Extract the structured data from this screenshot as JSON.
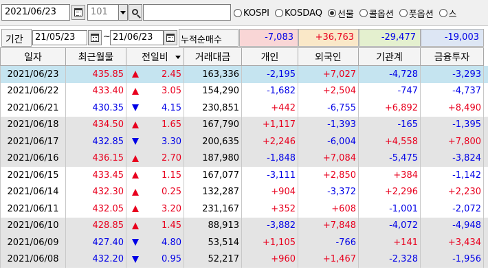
{
  "toolbar": {
    "date": "2021/06/23",
    "code": "101",
    "name": "",
    "radios": [
      {
        "label": "KOSPI",
        "selected": false
      },
      {
        "label": "KOSDAQ",
        "selected": false
      },
      {
        "label": "선물",
        "selected": true
      },
      {
        "label": "콜옵션",
        "selected": false
      },
      {
        "label": "풋옵션",
        "selected": false
      },
      {
        "label": "스",
        "selected": false
      }
    ]
  },
  "filter": {
    "period_label": "기간",
    "start_date": "21/05/23",
    "tilde": "~",
    "end_date": "21/06/23",
    "net_label": "누적순매수",
    "sums": [
      "-7,083",
      "+36,763",
      "-29,477",
      "-19,003"
    ]
  },
  "colors": {
    "up": "#e8001e",
    "down": "#0000e6",
    "selected_row": "#c5e4f0",
    "gray_row": "#e4e4e4",
    "sum_individual": "#f9d6d6",
    "sum_foreign": "#fae8c8",
    "sum_institution": "#e4f0cf",
    "sum_finance": "#dde6f4"
  },
  "table": {
    "headers": [
      "일자",
      "최근월물",
      "전일비",
      "거래대금",
      "개인",
      "외국인",
      "기관계",
      "금융투자"
    ],
    "rows": [
      {
        "date": "2021/06/23",
        "price": "435.85",
        "dir": "up",
        "change": "2.45",
        "amount": "163,336",
        "individual": "-2,195",
        "foreign": "+7,027",
        "institution": "-4,728",
        "finance": "-3,293"
      },
      {
        "date": "2021/06/22",
        "price": "433.40",
        "dir": "up",
        "change": "3.05",
        "amount": "154,290",
        "individual": "-1,682",
        "foreign": "+2,504",
        "institution": "-747",
        "finance": "-4,737"
      },
      {
        "date": "2021/06/21",
        "price": "430.35",
        "dir": "down",
        "change": "4.15",
        "amount": "230,851",
        "individual": "+442",
        "foreign": "-6,755",
        "institution": "+6,892",
        "finance": "+8,490"
      },
      {
        "date": "2021/06/18",
        "price": "434.50",
        "dir": "up",
        "change": "1.65",
        "amount": "167,790",
        "individual": "+1,117",
        "foreign": "-1,393",
        "institution": "-165",
        "finance": "-1,395"
      },
      {
        "date": "2021/06/17",
        "price": "432.85",
        "dir": "down",
        "change": "3.30",
        "amount": "200,635",
        "individual": "+2,246",
        "foreign": "-6,004",
        "institution": "+4,558",
        "finance": "+7,800"
      },
      {
        "date": "2021/06/16",
        "price": "436.15",
        "dir": "up",
        "change": "2.70",
        "amount": "187,980",
        "individual": "-1,848",
        "foreign": "+7,084",
        "institution": "-5,475",
        "finance": "-3,824"
      },
      {
        "date": "2021/06/15",
        "price": "433.45",
        "dir": "up",
        "change": "1.15",
        "amount": "167,077",
        "individual": "-3,111",
        "foreign": "+2,850",
        "institution": "+384",
        "finance": "-1,142"
      },
      {
        "date": "2021/06/14",
        "price": "432.30",
        "dir": "up",
        "change": "0.25",
        "amount": "132,287",
        "individual": "+904",
        "foreign": "-3,372",
        "institution": "+2,296",
        "finance": "+2,230"
      },
      {
        "date": "2021/06/11",
        "price": "432.05",
        "dir": "up",
        "change": "3.20",
        "amount": "231,167",
        "individual": "+352",
        "foreign": "+608",
        "institution": "-1,001",
        "finance": "-2,072"
      },
      {
        "date": "2021/06/10",
        "price": "428.85",
        "dir": "up",
        "change": "1.45",
        "amount": "88,913",
        "individual": "-3,882",
        "foreign": "+7,848",
        "institution": "-4,072",
        "finance": "-4,948"
      },
      {
        "date": "2021/06/09",
        "price": "427.40",
        "dir": "down",
        "change": "4.80",
        "amount": "53,514",
        "individual": "+1,105",
        "foreign": "-766",
        "institution": "+141",
        "finance": "+3,434"
      },
      {
        "date": "2021/06/08",
        "price": "432.20",
        "dir": "down",
        "change": "0.95",
        "amount": "52,217",
        "individual": "+960",
        "foreign": "+1,467",
        "institution": "-2,328",
        "finance": "-1,956"
      }
    ]
  }
}
